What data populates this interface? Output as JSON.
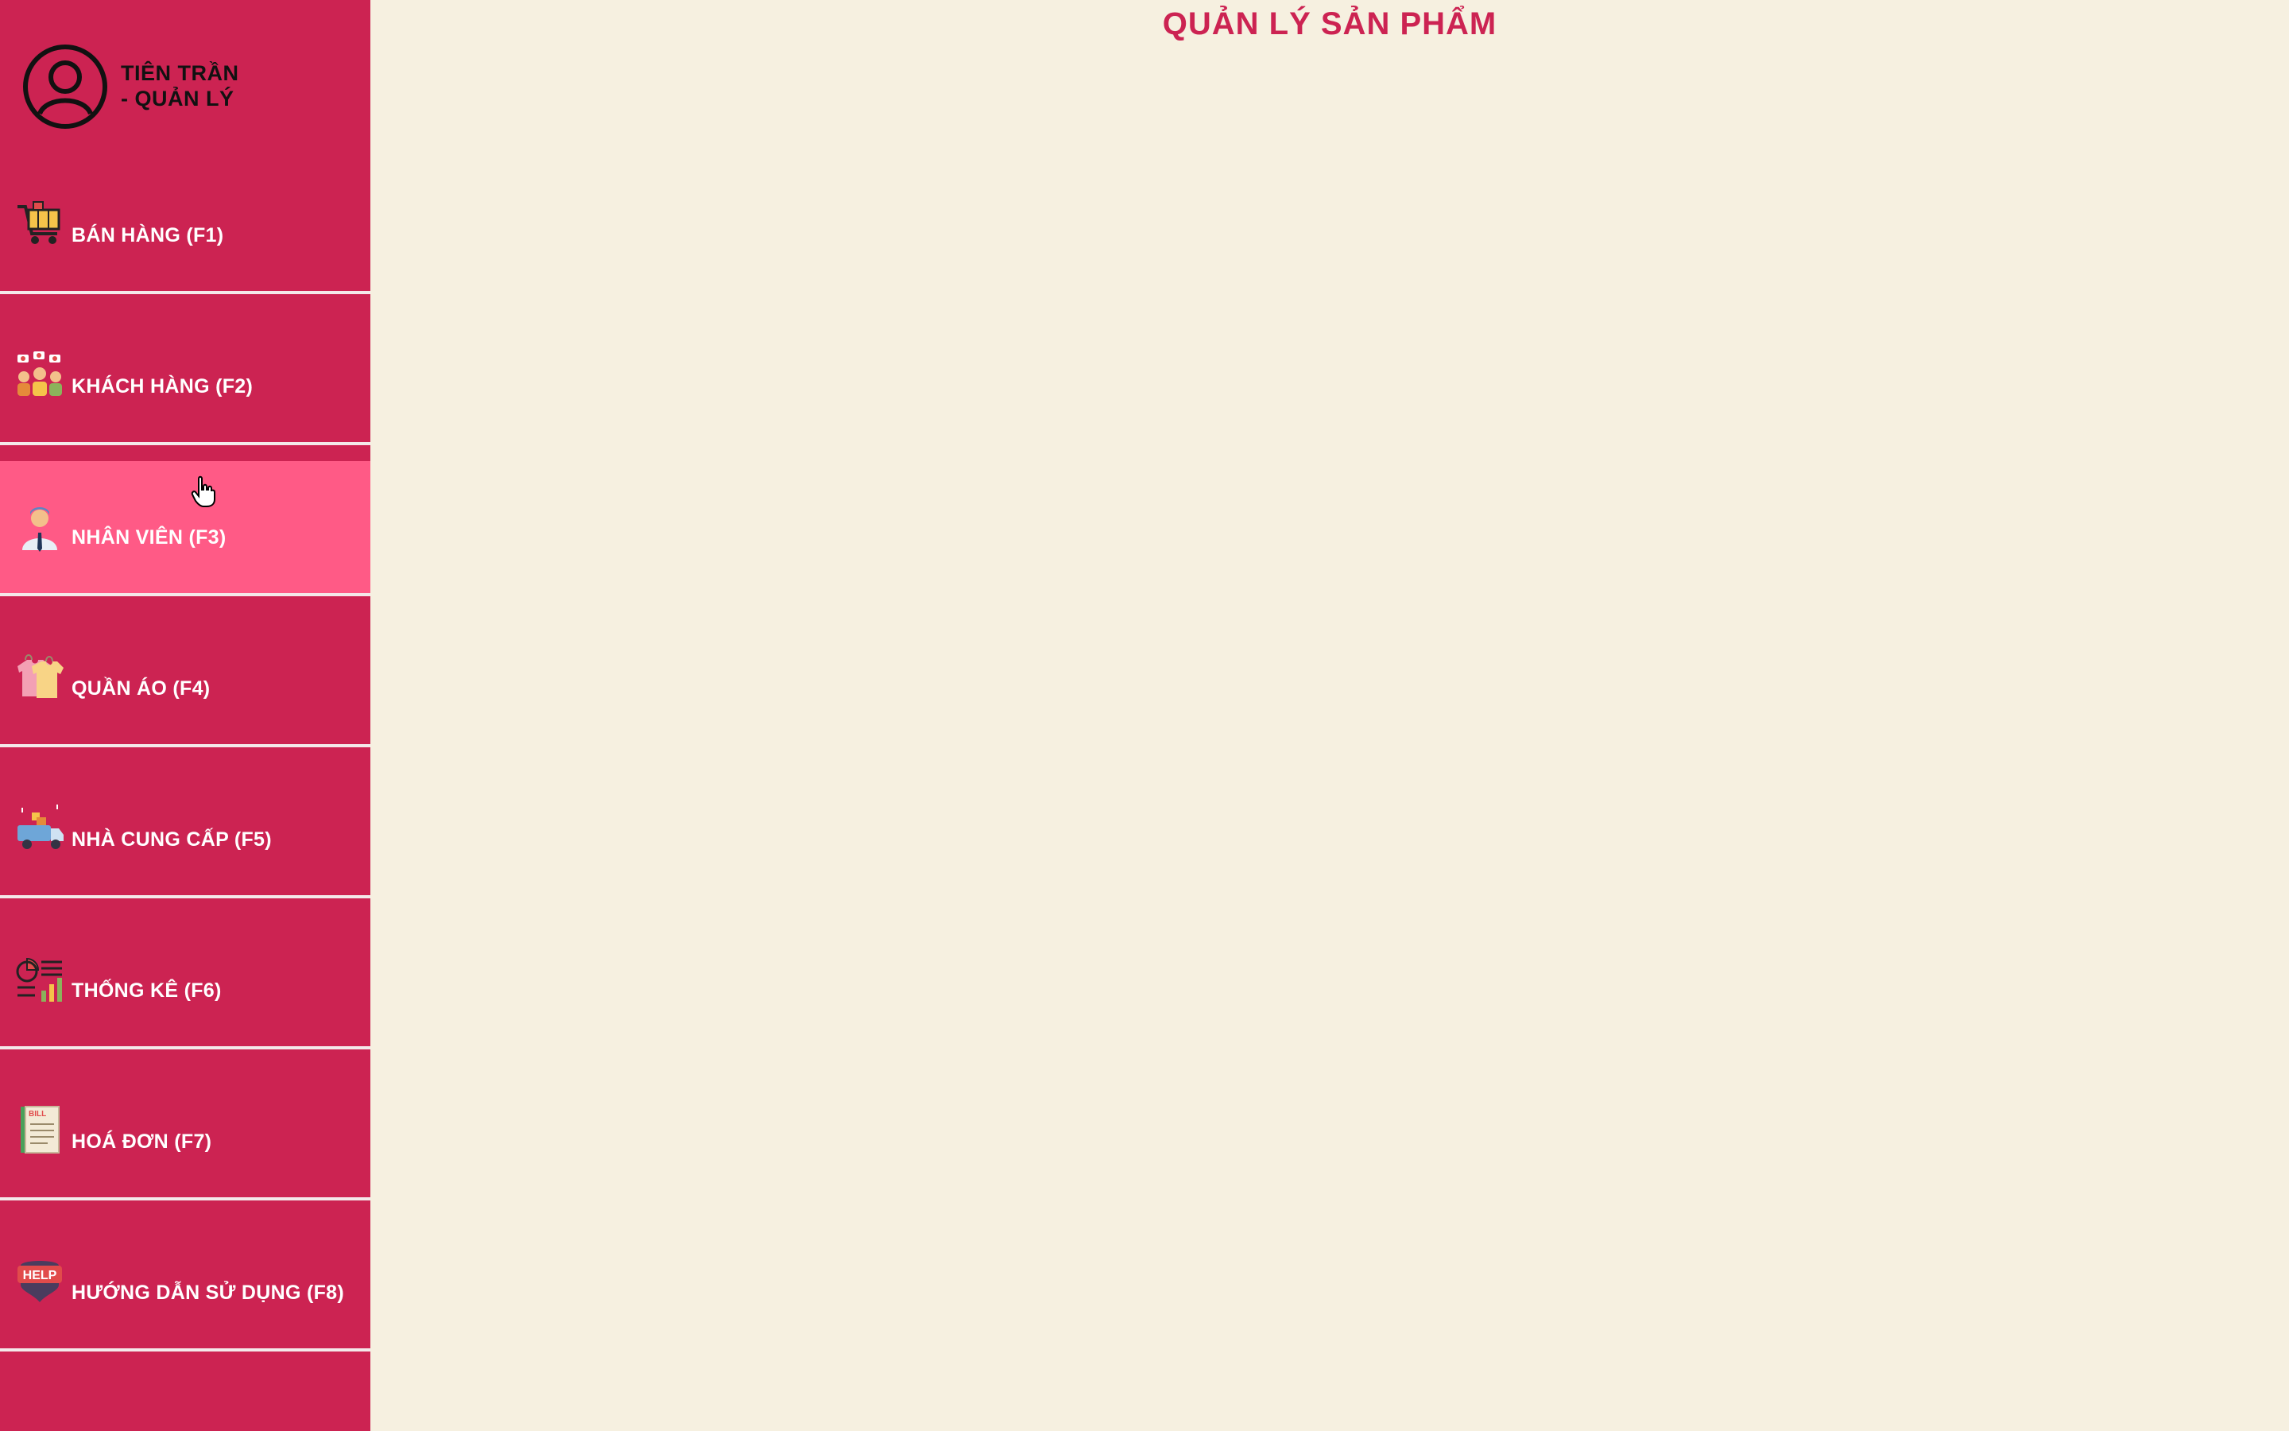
{
  "profile": {
    "name_line1": "TIÊN TRẦN",
    "name_line2": "- QUẢN LÝ",
    "icon": "user-circle-icon"
  },
  "page": {
    "title": "QUẢN LÝ SẢN PHẨM"
  },
  "nav": [
    {
      "label": "BÁN HÀNG (F1)",
      "icon": "shopping-cart-icon",
      "active": false
    },
    {
      "label": "KHÁCH HÀNG (F2)",
      "icon": "customers-icon",
      "active": false
    },
    {
      "label": "NHÂN VIÊN (F3)",
      "icon": "employee-icon",
      "active": true
    },
    {
      "label": "QUẦN ÁO (F4)",
      "icon": "clothes-icon",
      "active": false
    },
    {
      "label": "NHÀ CUNG CẤP (F5)",
      "icon": "delivery-truck-icon",
      "active": false
    },
    {
      "label": "THỐNG KÊ (F6)",
      "icon": "statistics-icon",
      "active": false
    },
    {
      "label": "HOÁ ĐƠN (F7)",
      "icon": "bill-icon",
      "active": false
    },
    {
      "label": "HƯỚNG DẪN SỬ DỤNG (F8)",
      "icon": "help-icon",
      "active": false
    }
  ],
  "icon_text": {
    "bill": "BILL",
    "help": "HELP"
  },
  "colors": {
    "sidebar": "#cc2352",
    "sidebar_active": "#ff5a86",
    "background": "#f6f0e0",
    "title": "#cc2352"
  }
}
